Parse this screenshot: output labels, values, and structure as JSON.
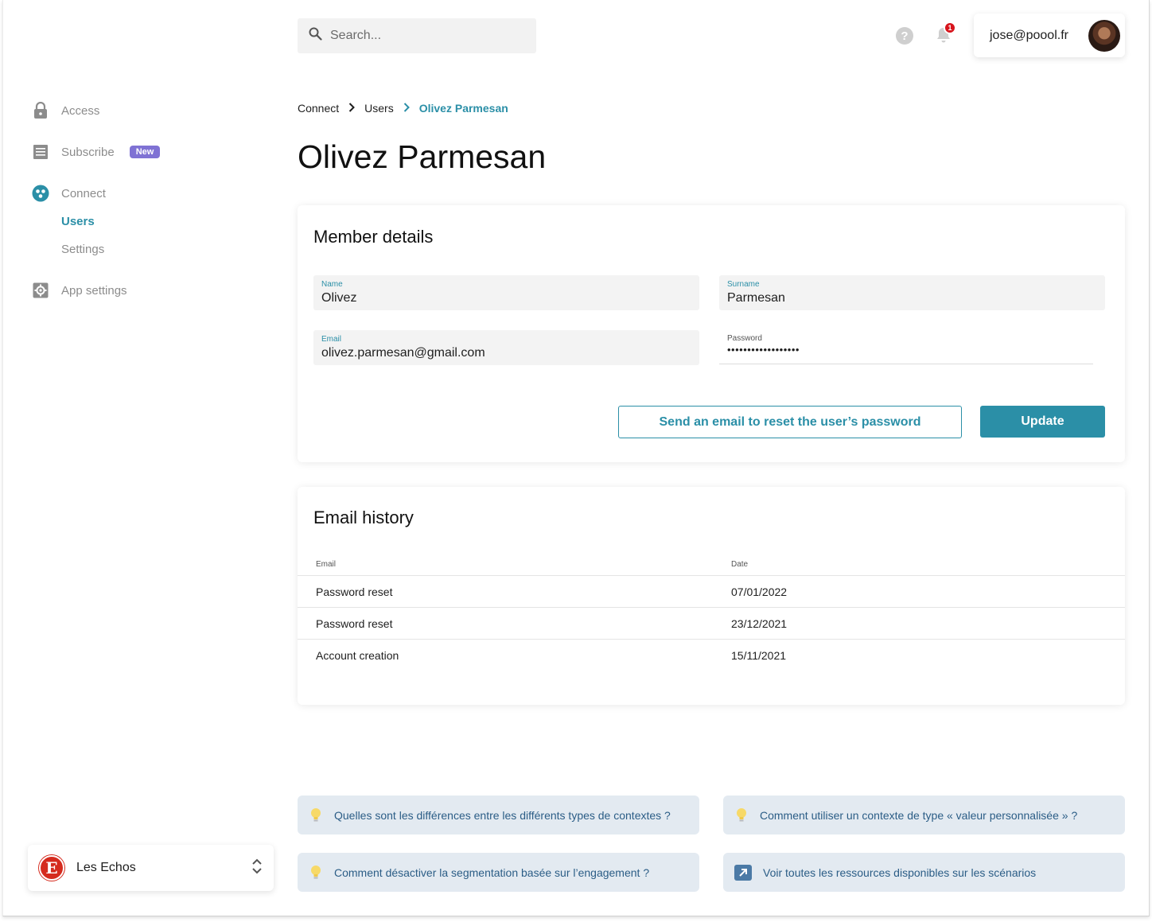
{
  "search": {
    "placeholder": "Search..."
  },
  "topbar": {
    "help_label": "?",
    "notification_count": "1",
    "user_email": "jose@poool.fr"
  },
  "sidebar": {
    "items": [
      {
        "label": "Access",
        "icon": "lock-icon"
      },
      {
        "label": "Subscribe",
        "icon": "receipt-icon",
        "badge": "New"
      },
      {
        "label": "Connect",
        "icon": "users-circle-icon",
        "children": [
          {
            "label": "Users"
          },
          {
            "label": "Settings"
          }
        ]
      },
      {
        "label": "App settings",
        "icon": "settings-box-icon"
      }
    ],
    "org": {
      "logo_letter": "E",
      "name": "Les Echos"
    }
  },
  "breadcrumb": [
    "Connect",
    "Users",
    "Olivez Parmesan"
  ],
  "page_title": "Olivez Parmesan",
  "member_details": {
    "title": "Member details",
    "name": {
      "label": "Name",
      "value": "Olivez"
    },
    "surname": {
      "label": "Surname",
      "value": "Parmesan"
    },
    "email": {
      "label": "Email",
      "value": "olivez.parmesan@gmail.com"
    },
    "password": {
      "label": "Password",
      "value": "••••••••••••••••••"
    },
    "reset_button": "Send an email to reset the user’s password",
    "update_button": "Update"
  },
  "email_history": {
    "title": "Email history",
    "columns": [
      "Email",
      "Date"
    ],
    "rows": [
      [
        "Password reset",
        "07/01/2022"
      ],
      [
        "Password reset",
        "23/12/2021"
      ],
      [
        "Account creation",
        "15/11/2021"
      ]
    ]
  },
  "resources": [
    {
      "text": "Quelles sont les différences entre les différents types de contextes ?",
      "icon": "lightbulb-icon"
    },
    {
      "text": "Comment utiliser un contexte de type « valeur personnalisée » ?",
      "icon": "lightbulb-icon"
    },
    {
      "text": "Comment désactiver la segmentation basée sur l’engagement ?",
      "icon": "lightbulb-icon"
    },
    {
      "text": "Voir toutes les ressources disponibles sur les scénarios",
      "icon": "external-link-icon"
    }
  ],
  "colors": {
    "accent": "#2b8fa7",
    "badge": "#7f72d4",
    "notification": "#d7141c",
    "resource_bg": "#e3eaf1"
  }
}
